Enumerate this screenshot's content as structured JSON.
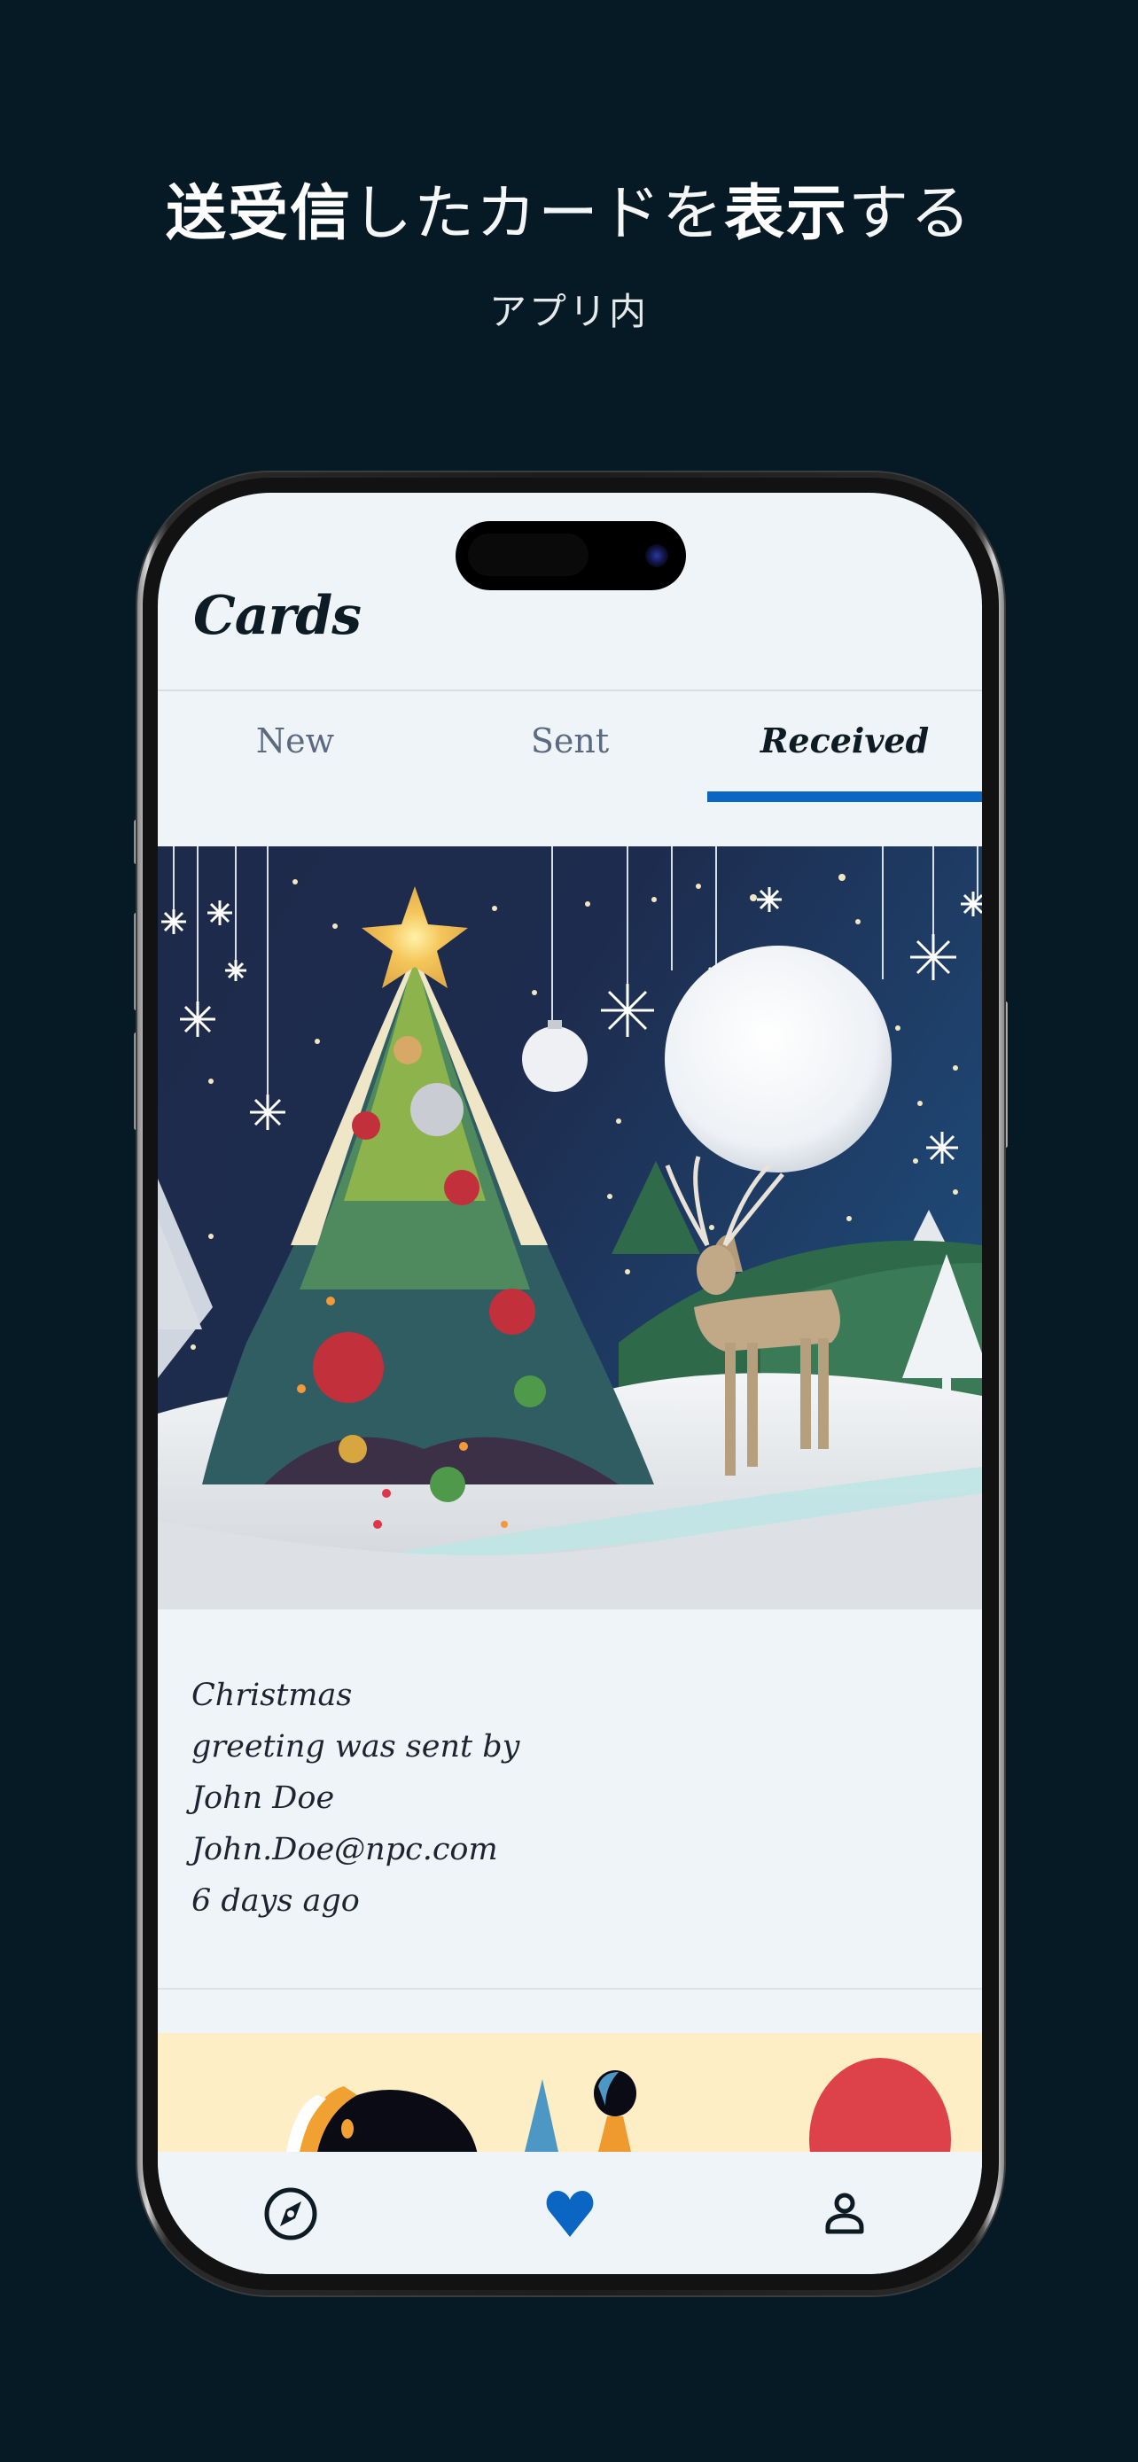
{
  "promo": {
    "headline_parts": [
      {
        "text": "送受信",
        "weight": "bold"
      },
      {
        "text": "したカードを",
        "weight": "thin"
      },
      {
        "text": "表示",
        "weight": "bold"
      },
      {
        "text": "する",
        "weight": "thin"
      }
    ],
    "subtitle": "アプリ内"
  },
  "app": {
    "title": "Cards",
    "tabs": [
      {
        "label": "New",
        "active": false
      },
      {
        "label": "Sent",
        "active": false
      },
      {
        "label": "Received",
        "active": true
      }
    ],
    "cards": [
      {
        "image_description": "Paper-craft Christmas scene: decorated tree with star, moon, hanging snowflakes, reindeer on snowy hills",
        "lines": [
          "Christmas",
          "greeting was sent by",
          "John Doe",
          "John.Doe@npc.com",
          "6 days ago"
        ]
      },
      {
        "image_description": "Minimalist illustration with shapes on pale yellow background (partially visible)"
      }
    ],
    "bottom_nav": [
      {
        "icon": "compass-icon",
        "label": "Explore",
        "active": false
      },
      {
        "icon": "heart-icon",
        "label": "Cards",
        "active": true
      },
      {
        "icon": "person-icon",
        "label": "Profile",
        "active": false
      }
    ]
  },
  "colors": {
    "background": "#051a24",
    "screen": "#eff4f8",
    "accent": "#0a66c2",
    "text_primary": "#0d1b24",
    "text_muted": "#5b6a80",
    "card2_bg": "#fdeec6"
  }
}
